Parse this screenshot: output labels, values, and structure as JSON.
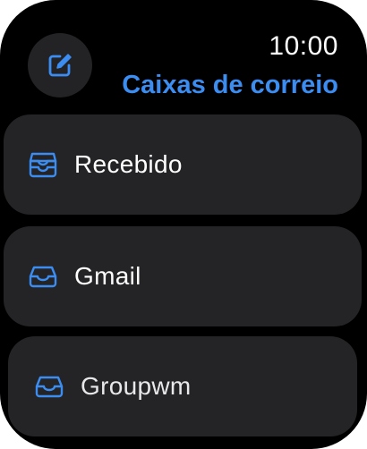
{
  "status_bar": {
    "time": "10:00"
  },
  "header": {
    "title": "Caixas de correio",
    "compose_icon": "compose-icon"
  },
  "mailboxes": [
    {
      "label": "Recebido",
      "icon": "inbox-stack-icon"
    },
    {
      "label": "Gmail",
      "icon": "inbox-tray-icon"
    },
    {
      "label": "Groupwm",
      "icon": "inbox-tray-icon"
    }
  ],
  "colors": {
    "accent": "#3c8df2",
    "background": "#000000",
    "row_background": "#242426",
    "compose_background": "#232325"
  }
}
